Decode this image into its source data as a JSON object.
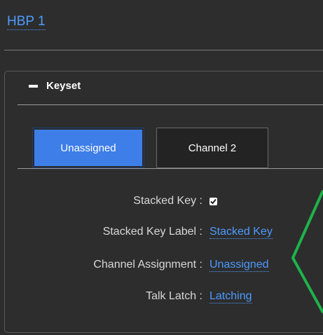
{
  "header": {
    "device_title": "HBP 1"
  },
  "keyset_panel": {
    "title": "Keyset",
    "tabs": [
      {
        "label": "Unassigned",
        "active": true
      },
      {
        "label": "Channel 2",
        "active": false
      }
    ],
    "properties": {
      "stacked_key": {
        "label": "Stacked Key :",
        "checked": true
      },
      "stacked_key_label": {
        "label": "Stacked Key Label :",
        "value": "Stacked Key"
      },
      "channel_assignment": {
        "label": "Channel Assignment :",
        "value": "Unassigned"
      },
      "talk_latch": {
        "label": "Talk Latch :",
        "value": "Latching"
      }
    }
  },
  "colors": {
    "background": "#2d2d2d",
    "accent": "#3d7ee8",
    "link": "#4d9bff",
    "annotation": "#1fb24a"
  }
}
